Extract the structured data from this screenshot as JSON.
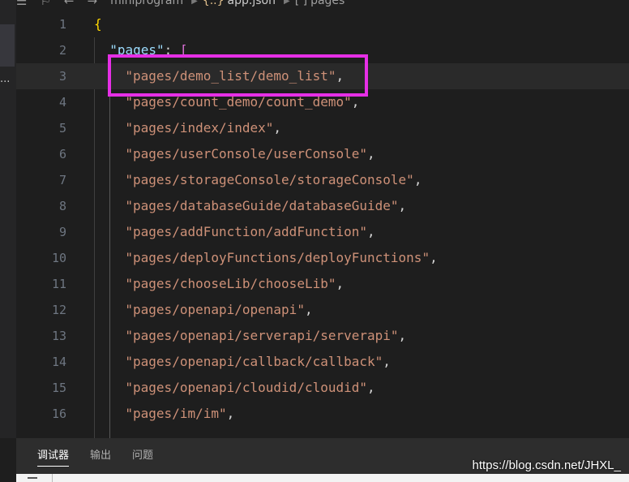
{
  "breadcrumb": {
    "folder": "miniprogram",
    "file": "app.json",
    "json_icon": "{..}",
    "symbol_icon": "[ ]",
    "symbol": "pages"
  },
  "sidebar": {
    "truncated_label": "..."
  },
  "editor": {
    "current_line": 3,
    "lines": [
      {
        "n": "1",
        "indent": 0,
        "parts": [
          {
            "t": "{",
            "c": "brace"
          }
        ]
      },
      {
        "n": "2",
        "indent": 1,
        "parts": [
          {
            "t": "\"pages\"",
            "c": "key"
          },
          {
            "t": ": ",
            "c": "punc"
          },
          {
            "t": "[",
            "c": "bracket"
          }
        ]
      },
      {
        "n": "3",
        "indent": 2,
        "parts": [
          {
            "t": "\"pages/demo_list/demo_list\"",
            "c": "str"
          },
          {
            "t": ",",
            "c": "punc"
          }
        ]
      },
      {
        "n": "4",
        "indent": 2,
        "parts": [
          {
            "t": "\"pages/count_demo/count_demo\"",
            "c": "str"
          },
          {
            "t": ",",
            "c": "punc"
          }
        ]
      },
      {
        "n": "5",
        "indent": 2,
        "parts": [
          {
            "t": "\"pages/index/index\"",
            "c": "str"
          },
          {
            "t": ",",
            "c": "punc"
          }
        ]
      },
      {
        "n": "6",
        "indent": 2,
        "parts": [
          {
            "t": "\"pages/userConsole/userConsole\"",
            "c": "str"
          },
          {
            "t": ",",
            "c": "punc"
          }
        ]
      },
      {
        "n": "7",
        "indent": 2,
        "parts": [
          {
            "t": "\"pages/storageConsole/storageConsole\"",
            "c": "str"
          },
          {
            "t": ",",
            "c": "punc"
          }
        ]
      },
      {
        "n": "8",
        "indent": 2,
        "parts": [
          {
            "t": "\"pages/databaseGuide/databaseGuide\"",
            "c": "str"
          },
          {
            "t": ",",
            "c": "punc"
          }
        ]
      },
      {
        "n": "9",
        "indent": 2,
        "parts": [
          {
            "t": "\"pages/addFunction/addFunction\"",
            "c": "str"
          },
          {
            "t": ",",
            "c": "punc"
          }
        ]
      },
      {
        "n": "10",
        "indent": 2,
        "parts": [
          {
            "t": "\"pages/deployFunctions/deployFunctions\"",
            "c": "str"
          },
          {
            "t": ",",
            "c": "punc"
          }
        ]
      },
      {
        "n": "11",
        "indent": 2,
        "parts": [
          {
            "t": "\"pages/chooseLib/chooseLib\"",
            "c": "str"
          },
          {
            "t": ",",
            "c": "punc"
          }
        ]
      },
      {
        "n": "12",
        "indent": 2,
        "parts": [
          {
            "t": "\"pages/openapi/openapi\"",
            "c": "str"
          },
          {
            "t": ",",
            "c": "punc"
          }
        ]
      },
      {
        "n": "13",
        "indent": 2,
        "parts": [
          {
            "t": "\"pages/openapi/serverapi/serverapi\"",
            "c": "str"
          },
          {
            "t": ",",
            "c": "punc"
          }
        ]
      },
      {
        "n": "14",
        "indent": 2,
        "parts": [
          {
            "t": "\"pages/openapi/callback/callback\"",
            "c": "str"
          },
          {
            "t": ",",
            "c": "punc"
          }
        ]
      },
      {
        "n": "15",
        "indent": 2,
        "parts": [
          {
            "t": "\"pages/openapi/cloudid/cloudid\"",
            "c": "str"
          },
          {
            "t": ",",
            "c": "punc"
          }
        ]
      },
      {
        "n": "16",
        "indent": 2,
        "parts": [
          {
            "t": "\"pages/im/im\"",
            "c": "str"
          },
          {
            "t": ",",
            "c": "punc"
          }
        ]
      }
    ]
  },
  "panel": {
    "tabs": [
      {
        "label": "调试器",
        "active": true
      },
      {
        "label": "输出",
        "active": false
      },
      {
        "label": "问题",
        "active": false
      }
    ]
  },
  "watermark": "https://blog.csdn.net/JHXL_",
  "colors": {
    "highlight_box": "#e62fe6",
    "string": "#ce9178",
    "key": "#9cdcfe",
    "background": "#1e1e1e"
  }
}
